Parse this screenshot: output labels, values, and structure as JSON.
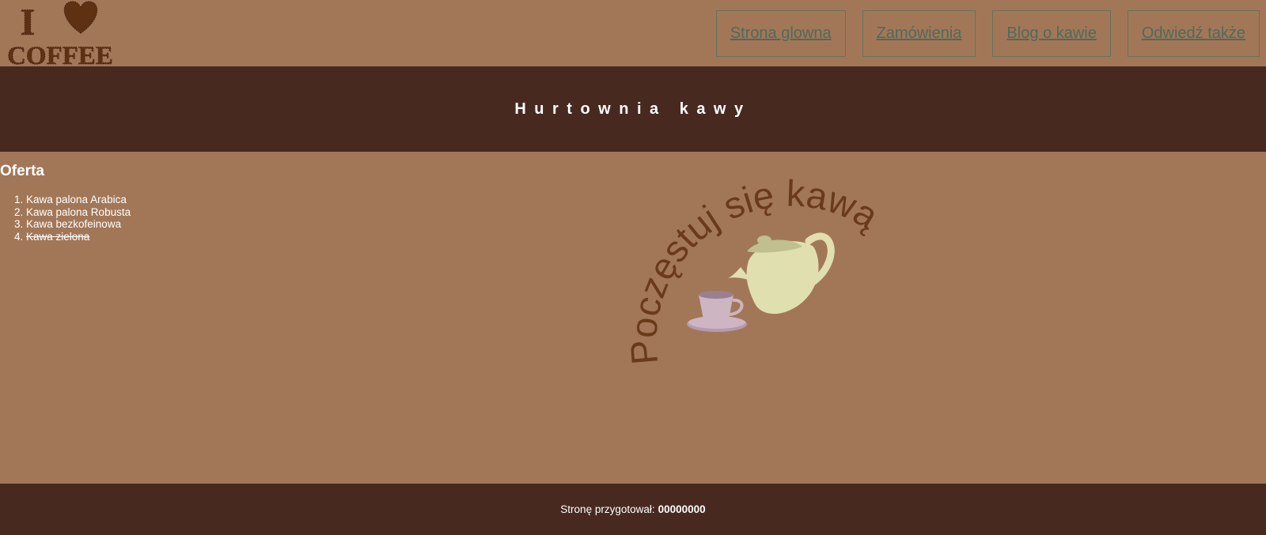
{
  "logo": {
    "line1": "I",
    "line2": "COFFEE"
  },
  "nav": {
    "items": [
      {
        "label": "Strona glowna"
      },
      {
        "label": "Zamówienia"
      },
      {
        "label": "Blog o kawie"
      },
      {
        "label": "Odwiedź także"
      }
    ]
  },
  "banner": {
    "title": "Hurtownia kawy"
  },
  "offer": {
    "heading": "Oferta",
    "items": [
      {
        "label": "Kawa palona Arabica"
      },
      {
        "label": "Kawa palona Robusta"
      },
      {
        "label": "Kawa bezkofeinowa"
      },
      {
        "label": "Kawa zielona"
      }
    ]
  },
  "illustration": {
    "arc_text": "Poczęstuj się kawą"
  },
  "footer": {
    "prefix": "Stronę przygotował:",
    "author": "00000000"
  },
  "colors": {
    "background": "#a27758",
    "dark": "#472920",
    "nav_text": "#4f6a5c",
    "arc_text": "#6a3a1a",
    "teapot": "#e0dfb0",
    "cup": "#cdb5c2"
  },
  "icons": [
    "heart-icon",
    "teapot-icon",
    "cup-icon"
  ]
}
